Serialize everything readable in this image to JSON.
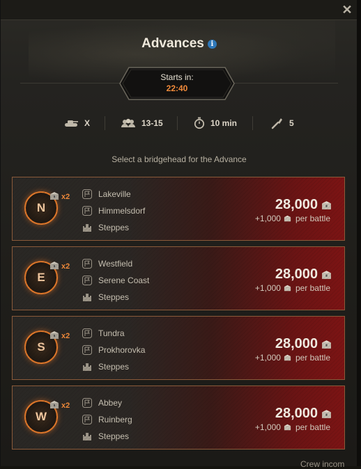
{
  "window": {
    "title": "Advances",
    "close_icon": "close-icon"
  },
  "timer": {
    "label": "Starts in:",
    "time": "22:40"
  },
  "stats": [
    {
      "icon": "tank-icon",
      "value": "X"
    },
    {
      "icon": "team-icon",
      "value": "13-15"
    },
    {
      "icon": "stopwatch-icon",
      "value": "10 min"
    },
    {
      "icon": "wrench-icon",
      "value": "5"
    }
  ],
  "select_text": "Select a bridgehead for the Advance",
  "bridgeheads": [
    {
      "letter": "N",
      "multiplier": "x2",
      "maps": [
        "Lakeville",
        "Himmelsdorf",
        "Steppes"
      ],
      "reward": "28,000",
      "per_battle": "+1,000",
      "per_battle_label": "per battle"
    },
    {
      "letter": "E",
      "multiplier": "x2",
      "maps": [
        "Westfield",
        "Serene Coast",
        "Steppes"
      ],
      "reward": "28,000",
      "per_battle": "+1,000",
      "per_battle_label": "per battle"
    },
    {
      "letter": "S",
      "multiplier": "x2",
      "maps": [
        "Tundra",
        "Prokhorovka",
        "Steppes"
      ],
      "reward": "28,000",
      "per_battle": "+1,000",
      "per_battle_label": "per battle"
    },
    {
      "letter": "W",
      "multiplier": "x2",
      "maps": [
        "Abbey",
        "Ruinberg",
        "Steppes"
      ],
      "reward": "28,000",
      "per_battle": "+1,000",
      "per_battle_label": "per battle"
    }
  ],
  "footer_hint": "Crew incom",
  "colors": {
    "accent": "#f08a3a",
    "card_red": "#7c1414",
    "info_blue": "#2f78b8"
  }
}
